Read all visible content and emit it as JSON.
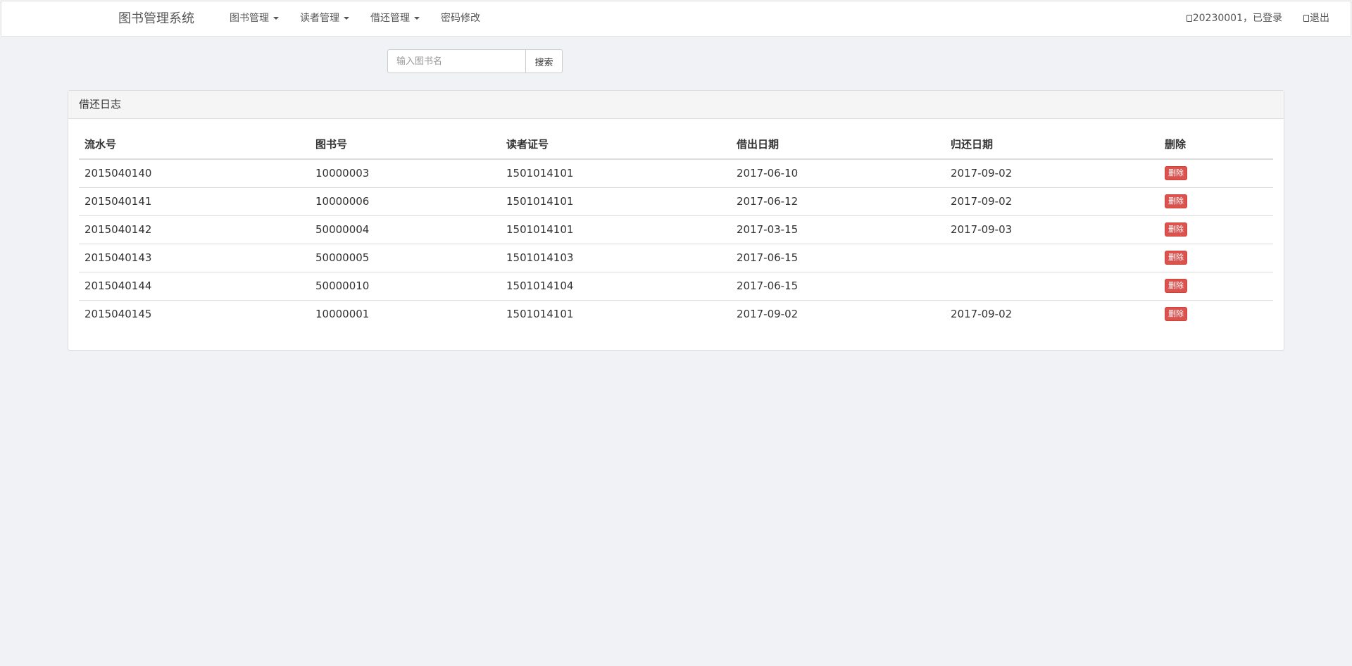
{
  "navbar": {
    "brand": "图书管理系统",
    "menu": [
      {
        "label": "图书管理",
        "dropdown": true
      },
      {
        "label": "读者管理",
        "dropdown": true
      },
      {
        "label": "借还管理",
        "dropdown": true
      },
      {
        "label": "密码修改",
        "dropdown": false
      }
    ],
    "user_status": "20230001，已登录",
    "logout_label": "退出"
  },
  "search": {
    "placeholder": "输入图书名",
    "value": "",
    "button_label": "搜索"
  },
  "panel": {
    "title": "借还日志",
    "columns": [
      "流水号",
      "图书号",
      "读者证号",
      "借出日期",
      "归还日期",
      "删除"
    ],
    "delete_label": "删除",
    "rows": [
      {
        "serial": "2015040140",
        "book_id": "10000003",
        "reader_id": "1501014101",
        "lend_date": "2017-06-10",
        "back_date": "2017-09-02"
      },
      {
        "serial": "2015040141",
        "book_id": "10000006",
        "reader_id": "1501014101",
        "lend_date": "2017-06-12",
        "back_date": "2017-09-02"
      },
      {
        "serial": "2015040142",
        "book_id": "50000004",
        "reader_id": "1501014101",
        "lend_date": "2017-03-15",
        "back_date": "2017-09-03"
      },
      {
        "serial": "2015040143",
        "book_id": "50000005",
        "reader_id": "1501014103",
        "lend_date": "2017-06-15",
        "back_date": ""
      },
      {
        "serial": "2015040144",
        "book_id": "50000010",
        "reader_id": "1501014104",
        "lend_date": "2017-06-15",
        "back_date": ""
      },
      {
        "serial": "2015040145",
        "book_id": "10000001",
        "reader_id": "1501014101",
        "lend_date": "2017-09-02",
        "back_date": "2017-09-02"
      }
    ]
  },
  "colors": {
    "background": "#f0f2f5",
    "danger": "#d9534f",
    "panel_heading": "#f5f5f5"
  }
}
